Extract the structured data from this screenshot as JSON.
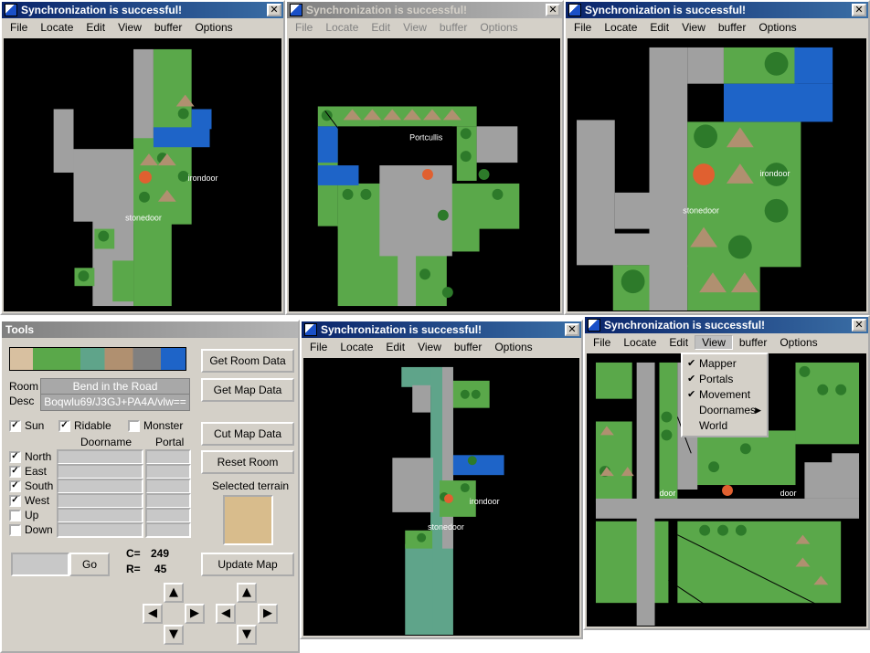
{
  "window_title": "Synchronization is successful!",
  "close_glyph": "✕",
  "menu": [
    "File",
    "Locate",
    "Edit",
    "View",
    "buffer",
    "Options"
  ],
  "map_labels": {
    "irondoor": "irondoor",
    "stonedoor": "stonedoor",
    "portcullis": "Portcullis",
    "door": "door"
  },
  "view_menu": {
    "items": [
      {
        "label": "Mapper",
        "checked": true
      },
      {
        "label": "Portals",
        "checked": true
      },
      {
        "label": "Movement",
        "checked": true
      },
      {
        "label": "Doornames",
        "submenu": true
      },
      {
        "label": "World"
      }
    ]
  },
  "tools": {
    "title": "Tools",
    "room_label": "Room",
    "room_value": "Bend in the Road",
    "desc_label": "Desc",
    "desc_value": "Boqwlu69/J3GJ+PA4A/vlw==",
    "get_room_data": "Get Room Data",
    "get_map_data": "Get Map Data",
    "cut_map_data": "Cut Map Data",
    "reset_room": "Reset Room",
    "selected_terrain": "Selected terrain",
    "update_map": "Update Map",
    "go": "Go",
    "sun": "Sun",
    "ridable": "Ridable",
    "monster": "Monster",
    "doorname_header": "Doorname",
    "portal_header": "Portal",
    "directions": [
      {
        "label": "North",
        "checked": true
      },
      {
        "label": "East",
        "checked": true
      },
      {
        "label": "South",
        "checked": true
      },
      {
        "label": "West",
        "checked": true
      },
      {
        "label": "Up",
        "checked": false
      },
      {
        "label": "Down",
        "checked": false
      }
    ],
    "c_label": "C=",
    "c_value": "249",
    "r_label": "R=",
    "r_value": "45",
    "sun_checked": true,
    "ridable_checked": true,
    "monster_checked": false
  },
  "colors": {
    "grass": "#5aa84a",
    "path": "#a0a0a0",
    "water": "#1e64c8",
    "road_teal": "#5fa48a",
    "title_active": "#0a246a"
  }
}
